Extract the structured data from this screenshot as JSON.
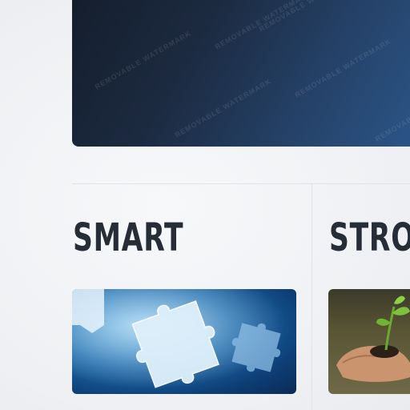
{
  "hero": {
    "watermark": "REMOVABLE WATERMARK"
  },
  "features": [
    {
      "title": "SMART",
      "image": "puzzle-pieces-image"
    },
    {
      "title": "STRO",
      "image": "plant-in-hand-image"
    }
  ]
}
